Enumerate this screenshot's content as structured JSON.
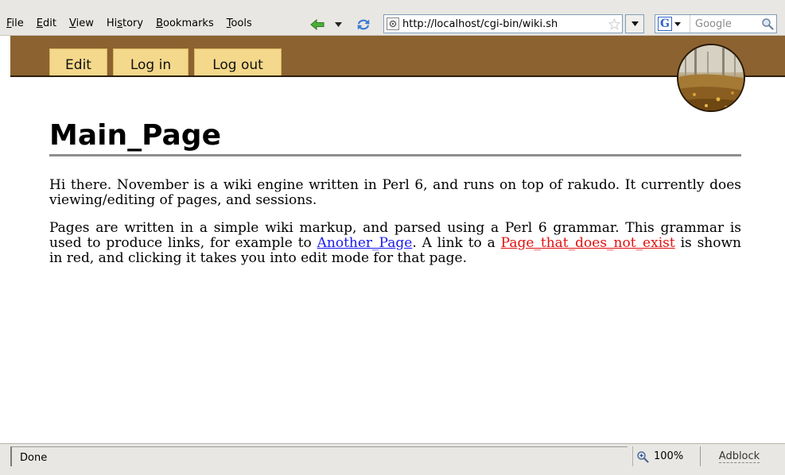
{
  "browser": {
    "menu": [
      {
        "label": "File",
        "mnemonic": "F"
      },
      {
        "label": "Edit",
        "mnemonic": "E"
      },
      {
        "label": "View",
        "mnemonic": "V"
      },
      {
        "label": "History",
        "mnemonic": "s"
      },
      {
        "label": "Bookmarks",
        "mnemonic": "B"
      },
      {
        "label": "Tools",
        "mnemonic": "T"
      }
    ],
    "url": "http://localhost/cgi-bin/wiki.sh",
    "search_placeholder": "Google",
    "search_engine": "G",
    "status": "Done",
    "zoom": "100%",
    "adblock_label": "Adblock"
  },
  "wiki": {
    "tabs": [
      {
        "label": "Edit"
      },
      {
        "label": "Log in"
      },
      {
        "label": "Log out"
      }
    ],
    "title": "Main_Page",
    "p1": "Hi there. November is a wiki engine written in Perl 6, and runs on top of rakudo. It currently does viewing/editing of pages, and sessions.",
    "p2_a": "Pages are written in a simple wiki markup, and parsed using a Perl 6 grammar. This grammar is used to produce links, for example to ",
    "link_existing": "Another_Page",
    "p2_b": ". A link to a ",
    "link_missing": "Page_that_does_not_exist",
    "p2_c": " is shown in red, and clicking it takes you into edit mode for that page."
  },
  "colors": {
    "header_brown": "#8c6230",
    "tab_yellow": "#f4d88b",
    "link_blue": "#1a1aee",
    "link_red": "#e01010"
  }
}
